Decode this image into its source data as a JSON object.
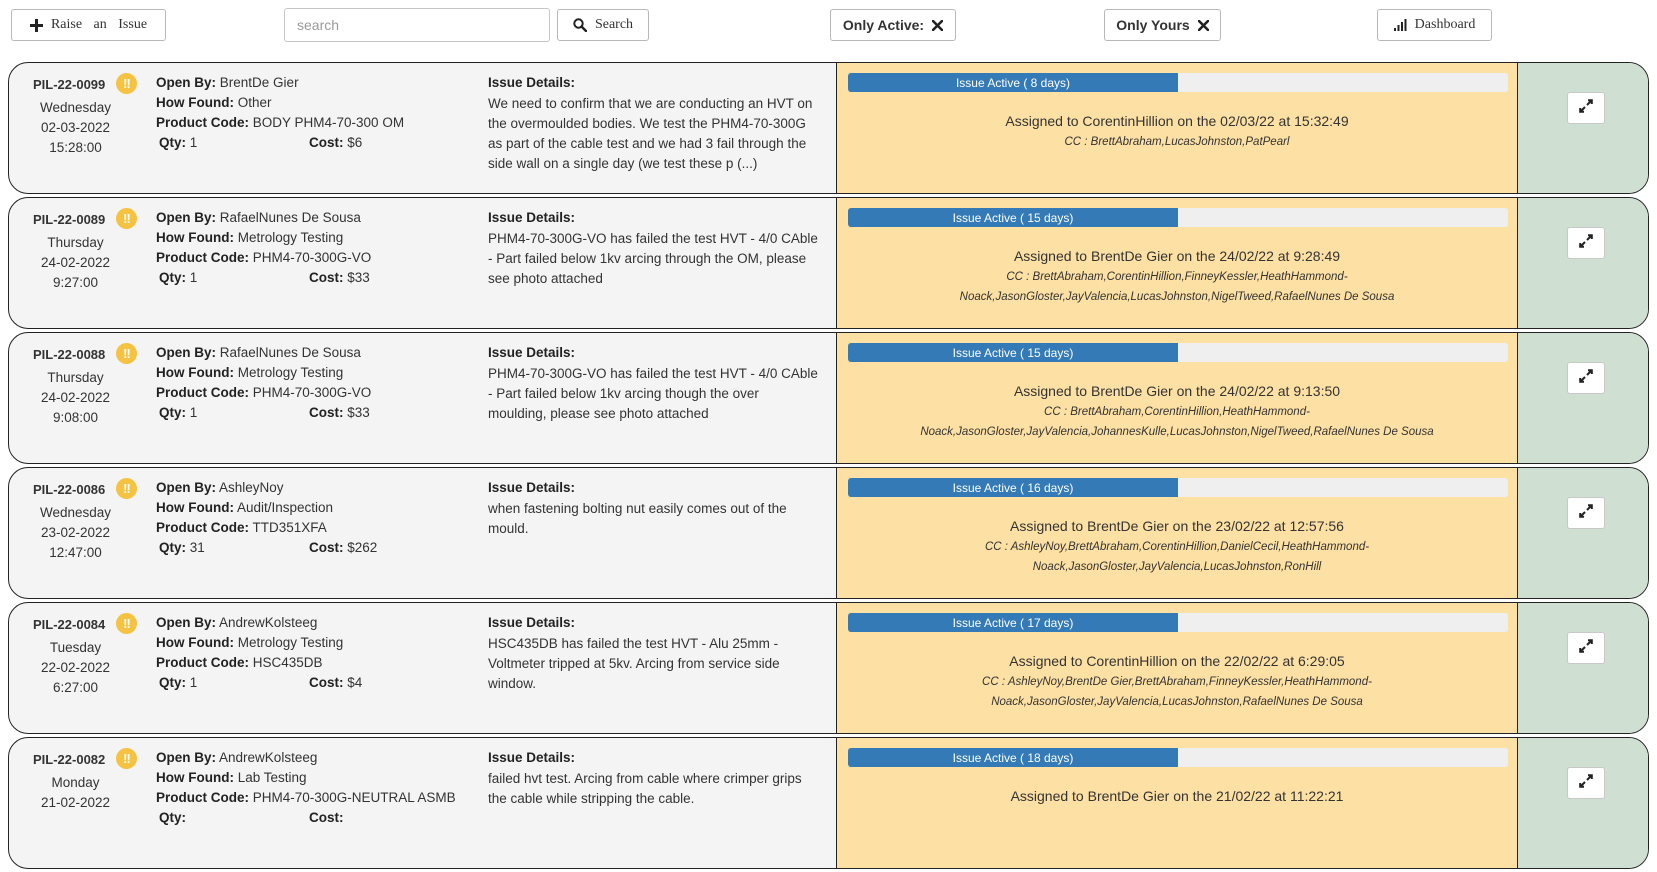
{
  "toolbar": {
    "raise_label": "Raise an Issue",
    "search_placeholder": "search",
    "search_label": "Search",
    "only_active_label": "Only Active:",
    "only_yours_label": "Only Yours",
    "dashboard_label": "Dashboard"
  },
  "labels": {
    "open_by": "Open By:",
    "how_found": "How Found:",
    "product_code": "Product Code:",
    "qty": "Qty:",
    "cost": "Cost:",
    "issue_details": "Issue Details:",
    "flag": "!!"
  },
  "colors": {
    "flag": "#f5c242",
    "progress": "#337ab7",
    "status_bg": "#fde0a3",
    "action_bg": "#cfdfd2"
  },
  "issues": [
    {
      "id": "PIL-22-0099",
      "day": "Wednesday",
      "date": "02-03-2022",
      "time": "15:28:00",
      "open_by": "BrentDe Gier",
      "how_found": "Other",
      "product_code": "BODY PHM4-70-300 OM",
      "qty": "1",
      "cost": "$6",
      "details": "We need to confirm that we are conducting an HVT on the overmoulded bodies. We test the PHM4-70-300G as part of the cable test and we had 3 fail through the side wall on a single day (we test these p (...)",
      "status": "Issue Active ( 8 days)",
      "progress": 0.5,
      "assigned": "Assigned to CorentinHillion on the 02/03/22 at 15:32:49",
      "cc": "CC : BrettAbraham,LucasJohnston,PatPearl"
    },
    {
      "id": "PIL-22-0089",
      "day": "Thursday",
      "date": "24-02-2022",
      "time": "9:27:00",
      "open_by": "RafaelNunes De Sousa",
      "how_found": "Metrology Testing",
      "product_code": "PHM4-70-300G-VO",
      "qty": "1",
      "cost": "$33",
      "details": "PHM4-70-300G-VO has failed the test HVT - 4/0 CAble - Part failed below 1kv arcing through the OM, please see photo attached",
      "status": "Issue Active ( 15 days)",
      "progress": 0.5,
      "assigned": "Assigned to BrentDe Gier on the 24/02/22 at 9:28:49",
      "cc": "CC : BrettAbraham,CorentinHillion,FinneyKessler,HeathHammond-Noack,JasonGloster,JayValencia,LucasJohnston,NigelTweed,RafaelNunes De Sousa"
    },
    {
      "id": "PIL-22-0088",
      "day": "Thursday",
      "date": "24-02-2022",
      "time": "9:08:00",
      "open_by": "RafaelNunes De Sousa",
      "how_found": "Metrology Testing",
      "product_code": "PHM4-70-300G-VO",
      "qty": "1",
      "cost": "$33",
      "details": "PHM4-70-300G-VO has failed the test HVT - 4/0 CAble - Part failed below 1kv arcing though the over moulding, please see photo attached",
      "status": "Issue Active ( 15 days)",
      "progress": 0.5,
      "assigned": "Assigned to BrentDe Gier on the 24/02/22 at 9:13:50",
      "cc": "CC : BrettAbraham,CorentinHillion,HeathHammond-Noack,JasonGloster,JayValencia,JohannesKulle,LucasJohnston,NigelTweed,RafaelNunes De Sousa"
    },
    {
      "id": "PIL-22-0086",
      "day": "Wednesday",
      "date": "23-02-2022",
      "time": "12:47:00",
      "open_by": "AshleyNoy",
      "how_found": "Audit/Inspection",
      "product_code": "TTD351XFA",
      "qty": "31",
      "cost": "$262",
      "details": "when fastening bolting nut easily comes out of the mould.",
      "status": "Issue Active ( 16 days)",
      "progress": 0.5,
      "assigned": "Assigned to BrentDe Gier on the 23/02/22 at 12:57:56",
      "cc": "CC : AshleyNoy,BrettAbraham,CorentinHillion,DanielCecil,HeathHammond-Noack,JasonGloster,JayValencia,LucasJohnston,RonHill"
    },
    {
      "id": "PIL-22-0084",
      "day": "Tuesday",
      "date": "22-02-2022",
      "time": "6:27:00",
      "open_by": "AndrewKolsteeg",
      "how_found": "Metrology Testing",
      "product_code": "HSC435DB",
      "qty": "1",
      "cost": "$4",
      "details": "HSC435DB has failed the test HVT - Alu 25mm - Voltmeter tripped at 5kv. Arcing from service side window.",
      "status": "Issue Active ( 17 days)",
      "progress": 0.5,
      "assigned": "Assigned to CorentinHillion on the 22/02/22 at 6:29:05",
      "cc": "CC : AshleyNoy,BrentDe Gier,BrettAbraham,FinneyKessler,HeathHammond-Noack,JasonGloster,JayValencia,LucasJohnston,RafaelNunes De Sousa"
    },
    {
      "id": "PIL-22-0082",
      "day": "Monday",
      "date": "21-02-2022",
      "time": "",
      "open_by": "AndrewKolsteeg",
      "how_found": "Lab Testing",
      "product_code": "PHM4-70-300G-NEUTRAL ASMB",
      "qty": "",
      "cost": "",
      "details": "failed hvt test. Arcing from cable where crimper grips the cable while stripping the cable.",
      "status": "Issue Active ( 18 days)",
      "progress": 0.5,
      "assigned": "Assigned to BrentDe Gier on the 21/02/22 at 11:22:21",
      "cc": ""
    }
  ]
}
